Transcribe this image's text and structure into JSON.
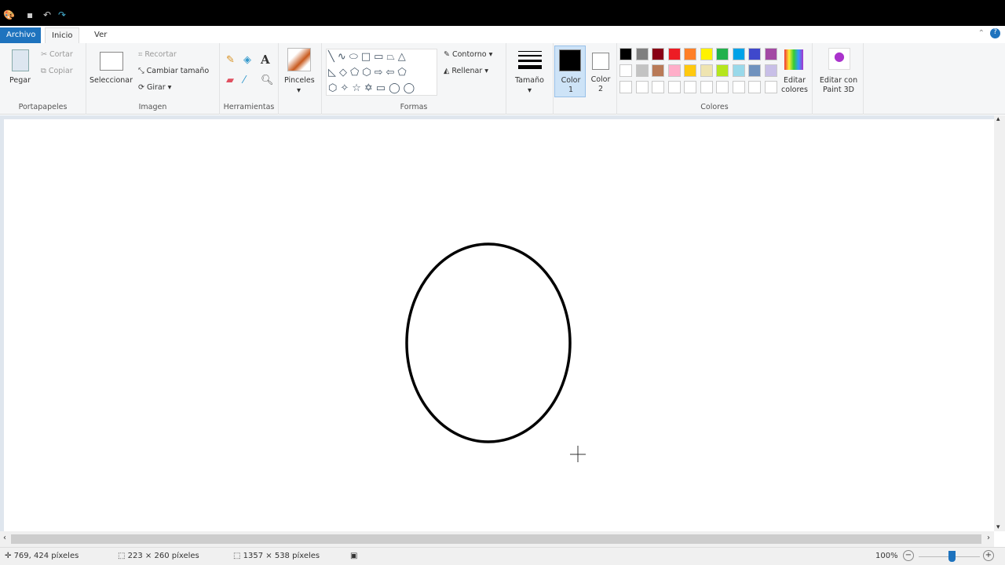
{
  "tabs": {
    "file": "Archivo",
    "home": "Inicio",
    "view": "Ver"
  },
  "clipboard": {
    "paste": "Pegar",
    "cut": "Cortar",
    "copy": "Copiar",
    "label": "Portapapeles"
  },
  "image": {
    "select": "Seleccionar",
    "crop": "Recortar",
    "resize": "Cambiar tamaño",
    "rotate": "Girar",
    "label": "Imagen"
  },
  "tools": {
    "label": "Herramientas"
  },
  "brushes": {
    "label": "Pinceles"
  },
  "shapes": {
    "outline": "Contorno",
    "fill": "Rellenar",
    "label": "Formas"
  },
  "size": {
    "label": "Tamaño"
  },
  "color1": {
    "label": "Color",
    "num": "1",
    "value": "#000000"
  },
  "color2": {
    "label": "Color",
    "num": "2",
    "value": "#ffffff"
  },
  "colors": {
    "label": "Colores",
    "edit": "Editar colores",
    "row1": [
      "#000000",
      "#7f7f7f",
      "#880015",
      "#ed1c24",
      "#ff7f27",
      "#fff200",
      "#22b14c",
      "#00a2e8",
      "#3f48cc",
      "#a349a4"
    ],
    "row2": [
      "#ffffff",
      "#c3c3c3",
      "#b97a57",
      "#ffaec9",
      "#ffc90e",
      "#efe4b0",
      "#b5e61d",
      "#99d9ea",
      "#7092be",
      "#c8bfe7"
    ]
  },
  "paint3d": {
    "label": "Editar con Paint 3D"
  },
  "status": {
    "cursor": "769, 424 píxeles",
    "selection": "223 × 260 píxeles",
    "canvas": "1357 × 538 píxeles",
    "zoom": "100%"
  }
}
